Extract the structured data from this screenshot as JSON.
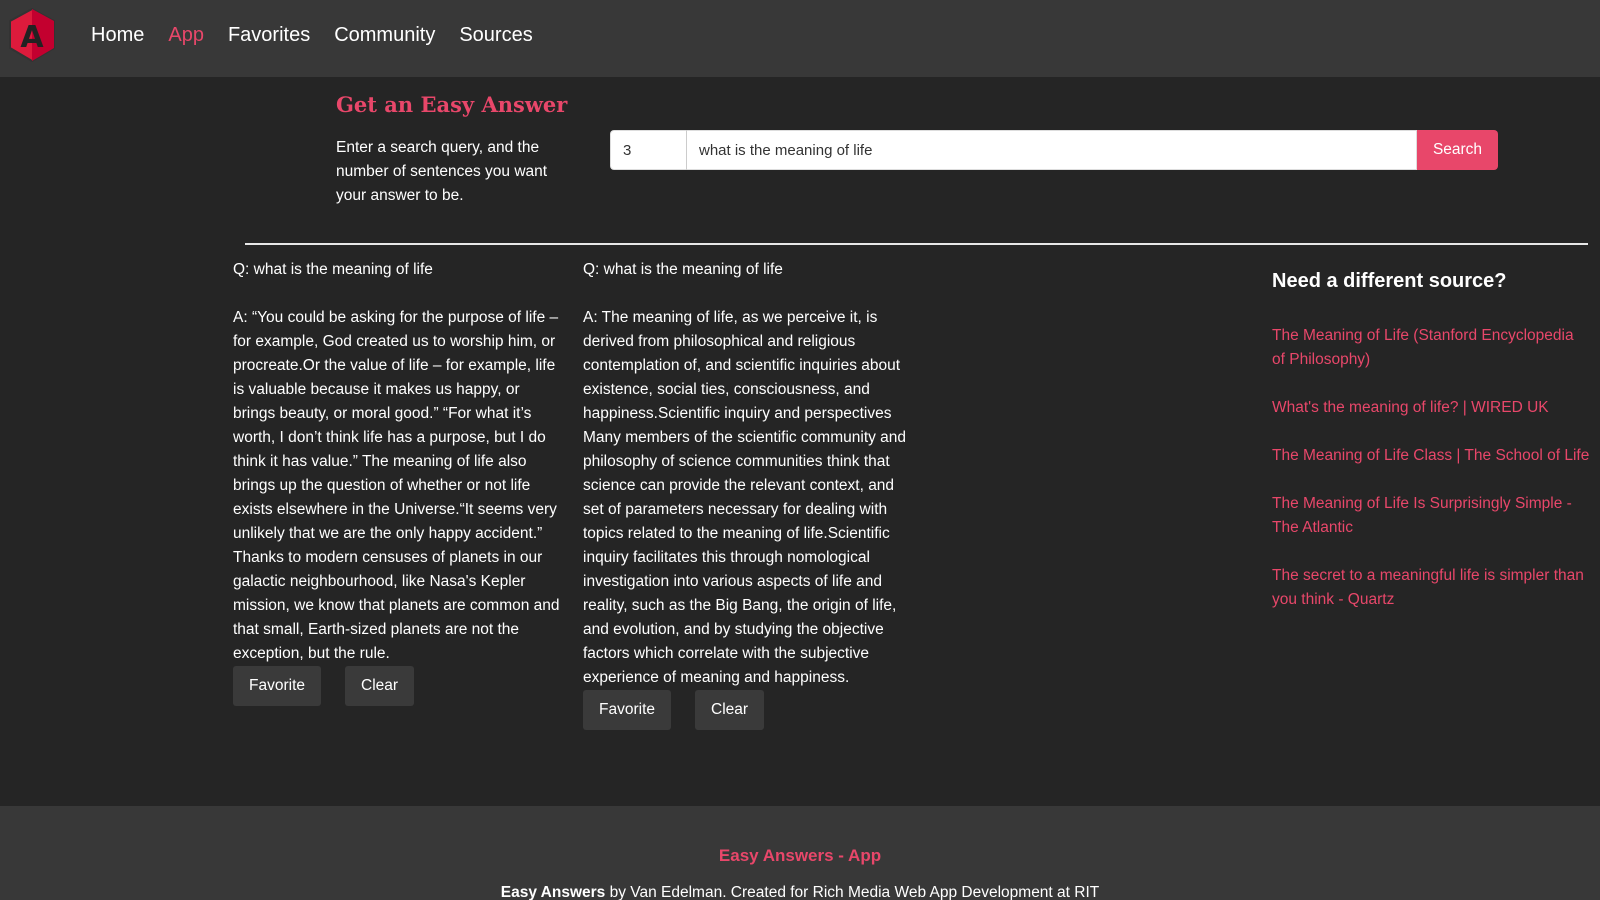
{
  "nav": {
    "logo_letter": "A",
    "brand_color": "#dd1b3c",
    "links": [
      "Home",
      "App",
      "Favorites",
      "Community",
      "Sources"
    ],
    "active": "App"
  },
  "header": {
    "title": "Get an Easy Answer",
    "intro": "Enter a search query, and the number of sentences you want your answer to be."
  },
  "search": {
    "count_value": "3",
    "query_value": "what is the meaning of life",
    "button_label": "Search"
  },
  "answers": [
    {
      "question": "Q: what is the meaning of life",
      "answer": "A: “You could be asking for the purpose of life – for example, God created us to worship him, or procreate.Or the value of life – for example, life is valuable because it makes us happy, or brings beauty, or moral good.” “For what it’s worth, I don’t think life has a purpose, but I do think it has value.” The meaning of life also brings up the question of whether or not life exists elsewhere in the Universe.“It seems very unlikely that we are the only happy accident.” Thanks to modern censuses of planets in our galactic neighbourhood, like Nasa's Kepler mission, we know that planets are common and that small, Earth-sized planets are not the exception, but the rule.",
      "favorite_label": "Favorite",
      "clear_label": "Clear"
    },
    {
      "question": "Q: what is the meaning of life",
      "answer": "A: The meaning of life, as we perceive it, is derived from philosophical and religious contemplation of, and scientific inquiries about existence, social ties, consciousness, and happiness.Scientific inquiry and perspectives Many members of the scientific community and philosophy of science communities think that science can provide the relevant context, and set of parameters necessary for dealing with topics related to the meaning of life.Scientific inquiry facilitates this through nomological investigation into various aspects of life and reality, such as the Big Bang, the origin of life, and evolution, and by studying the objective factors which correlate with the subjective experience of meaning and happiness.",
      "favorite_label": "Favorite",
      "clear_label": "Clear"
    }
  ],
  "sources": {
    "heading": "Need a different source?",
    "links": [
      "The Meaning of Life (Stanford Encyclopedia of Philosophy)",
      "What's the meaning of life? | WIRED UK",
      "The Meaning of Life Class | The School of Life",
      "The Meaning of Life Is Surprisingly Simple - The Atlantic",
      "The secret to a meaningful life is simpler than you think - Quartz"
    ]
  },
  "footer": {
    "title": "Easy Answers - App",
    "credit_brand": "Easy Answers",
    "credit_rest": " by Van Edelman. Created for Rich Media Web App Development at RIT"
  },
  "colors": {
    "accent": "#e8476a",
    "background": "#252525",
    "navbar": "#383838"
  }
}
